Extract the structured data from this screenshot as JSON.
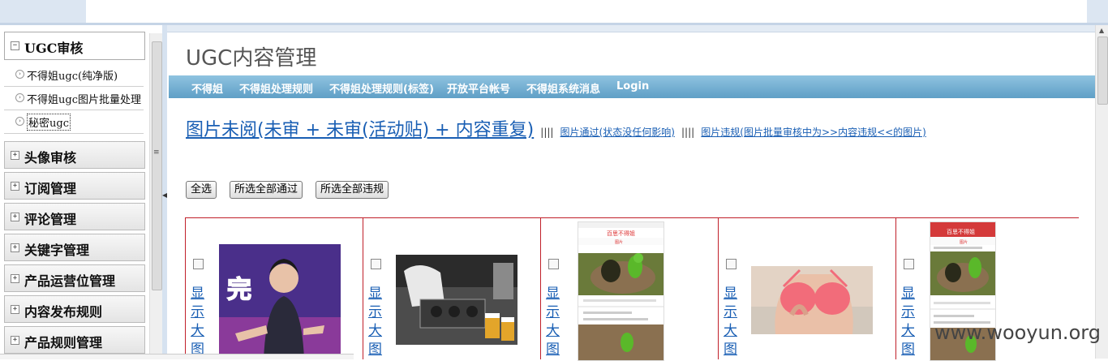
{
  "sidebar": {
    "open_group": {
      "title": "UGC审核",
      "items": [
        {
          "label": "不得姐ugc(纯净版)"
        },
        {
          "label": "不得姐ugc图片批量处理"
        },
        {
          "label": "秘密ugc"
        }
      ]
    },
    "groups": [
      {
        "title": "头像审核"
      },
      {
        "title": "订阅管理"
      },
      {
        "title": "评论管理"
      },
      {
        "title": "关键字管理"
      },
      {
        "title": "产品运营位管理"
      },
      {
        "title": "内容发布规则"
      },
      {
        "title": "产品规则管理"
      }
    ],
    "toggle_open": "−",
    "toggle_closed": "+",
    "grip": "≡"
  },
  "main": {
    "title": "UGC内容管理",
    "nav": [
      {
        "label": "不得姐"
      },
      {
        "label": "不得姐处理规则"
      },
      {
        "label": "不得姐处理规则(标签)"
      },
      {
        "label": "开放平台帐号"
      },
      {
        "label": "不得姐系统消息"
      },
      {
        "label": "Login"
      }
    ],
    "links": {
      "unread": "图片未阅(未审 + 未审(活动贴) + 内容重复)",
      "separator": "||||",
      "passed": "图片通过(状态没任何影响)",
      "violation": "图片违规(图片批量审核中为>>内容违规<<的图片)"
    },
    "buttons": {
      "select_all": "全选",
      "pass_all": "所选全部通过",
      "violate_all": "所选全部违规"
    },
    "cells": [
      {
        "show_label": "显示大图",
        "image": "woman-cheongsam-photo",
        "caption": "完"
      },
      {
        "show_label": "显示大图",
        "image": "worker-bar-photo"
      },
      {
        "show_label": "显示大图",
        "image": "app-screenshot-parrot",
        "app_title": "百思不得姐",
        "tab": "图片"
      },
      {
        "show_label": "显示大图",
        "image": "swimsuit-photo"
      },
      {
        "show_label": "显示大图",
        "image": "app-screenshot-parrot-2",
        "app_title": "百思不得姐",
        "tab": "图片"
      }
    ]
  },
  "watermark": "www.wooyun.org",
  "colors": {
    "nav_bg": "#6aa8cf",
    "link": "#1a5fb4",
    "grid_border": "#c0202a"
  }
}
